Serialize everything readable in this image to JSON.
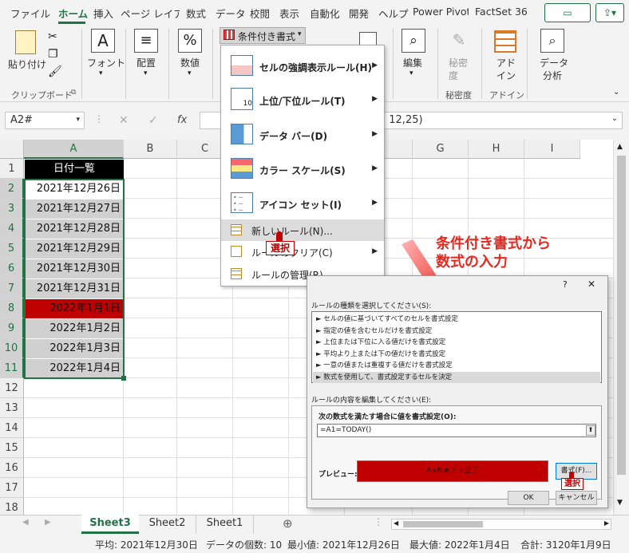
{
  "ribbon_tabs": [
    "ファイル",
    "ホーム",
    "挿入",
    "ページ レイアウト",
    "数式",
    "データ",
    "校閲",
    "表示",
    "自動化",
    "開発",
    "ヘルプ",
    "Power Pivot",
    "FactSet 36"
  ],
  "active_tab": "ホーム",
  "ribbon": {
    "paste": "貼り付け",
    "clipboard": "クリップボード",
    "font": "フォント",
    "alignment": "配置",
    "number": "数値",
    "cond_format": "条件付き書式",
    "edit": "編集",
    "sensitivity_btn1": "秘密",
    "sensitivity_btn2": "度",
    "sensitivity_group": "秘密度",
    "addin1": "アド",
    "addin2": "イン",
    "addin_group": "アドイン",
    "analyze1": "データ",
    "analyze2": "分析"
  },
  "formula_bar": {
    "name_box": "A2#",
    "fx": "fx",
    "formula_tail": ", 12,25)"
  },
  "columns": [
    "A",
    "B",
    "C",
    "D",
    "E",
    "F",
    "G",
    "H",
    "I"
  ],
  "rows": [
    "1",
    "2",
    "3",
    "4",
    "5",
    "6",
    "7",
    "8",
    "9",
    "10",
    "11",
    "12",
    "13",
    "14",
    "15",
    "16",
    "17",
    "18"
  ],
  "cells": {
    "header": "日付一覧",
    "dates": [
      "2021年12月26日",
      "2021年12月27日",
      "2021年12月28日",
      "2021年12月29日",
      "2021年12月30日",
      "2021年12月31日",
      "2022年1月1日",
      "2022年1月2日",
      "2022年1月3日",
      "2022年1月4日"
    ],
    "highlight_color": "#c00000"
  },
  "cf_menu": {
    "items": [
      "セルの強調表示ルール(H)",
      "上位/下位ルール(T)",
      "データ バー(D)",
      "カラー スケール(S)",
      "アイコン セット(I)",
      "新しいルール(N)...",
      "ルールのクリア(C)",
      "ルールの管理(R)..."
    ],
    "select_callout": "選択"
  },
  "annotation": {
    "line1": "条件付き書式から",
    "line2": "数式の入力",
    "color": "#e8281f"
  },
  "dialog": {
    "help": "?",
    "close": "✕",
    "rule_type_label": "ルールの種類を選択してください(S):",
    "rule_types": [
      "セルの値に基づいてすべてのセルを書式設定",
      "指定の値を含むセルだけを書式設定",
      "上位または下位に入る値だけを書式設定",
      "平均より上または下の値だけを書式設定",
      "一意の値または重複する値だけを書式設定",
      "数式を使用して、書式設定するセルを決定"
    ],
    "edit_label": "ルールの内容を編集してください(E):",
    "formula_label": "次の数式を満たす場合に値を書式設定(O):",
    "formula_value": "=A1=TODAY()",
    "preview_label": "プレビュー:",
    "preview_text": "Aaあぁアァ亜宇",
    "format_button": "書式(F)...",
    "format_callout": "選択",
    "ok": "OK",
    "cancel": "キャンセル"
  },
  "sheet_tabs": [
    "Sheet3",
    "Sheet2",
    "Sheet1"
  ],
  "active_sheet": "Sheet3",
  "status": {
    "average": "平均: 2021年12月30日",
    "count": "データの個数: 10",
    "min": "最小値: 2021年12月26日",
    "max": "最大値: 2022年1月4日",
    "sum": "合計: 3120年1月9日"
  }
}
